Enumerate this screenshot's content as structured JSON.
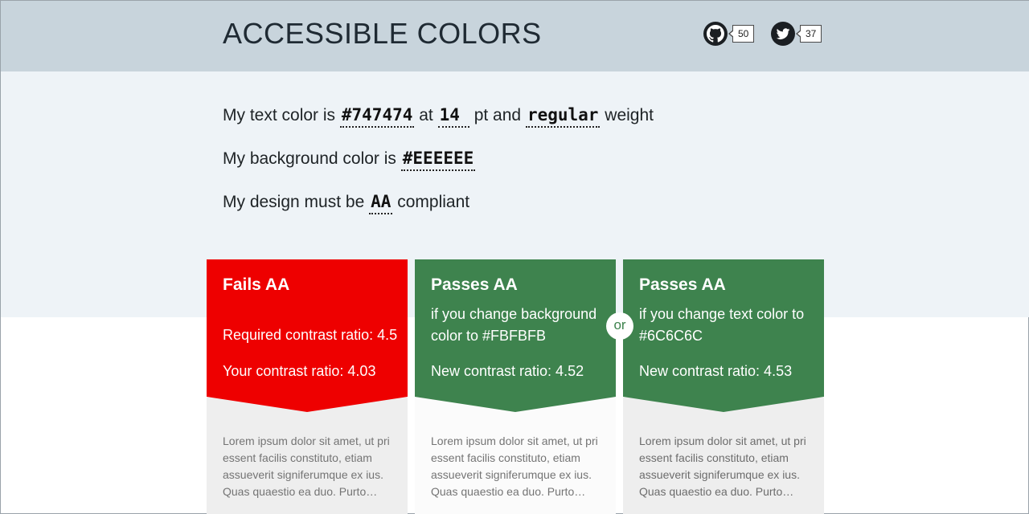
{
  "header": {
    "title": "ACCESSIBLE COLORS",
    "github": {
      "icon": "github-icon",
      "count": "50"
    },
    "twitter": {
      "icon": "twitter-icon",
      "count": "37"
    }
  },
  "config": {
    "line1": {
      "prefix": "My text color is ",
      "text_color": "#747474",
      "at": " at ",
      "size": "14",
      "pt_and": " pt and ",
      "weight": "regular",
      "suffix": " weight"
    },
    "line2": {
      "prefix": "My background color is ",
      "bg_color": "#EEEEEE"
    },
    "line3": {
      "prefix": "My design must be ",
      "level": "AA",
      "suffix": " compliant"
    }
  },
  "cards": [
    {
      "title": "Fails AA",
      "required": "Required contrast ratio: 4.5",
      "ratio": "Your contrast ratio: 4.03",
      "sample": "Lorem ipsum dolor sit amet, ut pri essent facilis constituto, etiam assueverit signiferumque ex ius. Quas quaestio ea duo. Purto…",
      "color": "#ee0000"
    },
    {
      "title": "Passes AA",
      "suggestion": "if you change background color to #FBFBFB",
      "ratio": "New contrast ratio: 4.52",
      "sample": "Lorem ipsum dolor sit amet, ut pri essent facilis constituto, etiam assueverit signiferumque ex ius. Quas quaestio ea duo. Purto…",
      "color": "#3e834e"
    },
    {
      "title": "Passes AA",
      "suggestion": "if you change text color to #6C6C6C",
      "ratio": "New contrast ratio: 4.53",
      "sample": "Lorem ipsum dolor sit amet, ut pri essent facilis constituto, etiam assueverit signiferumque ex ius. Quas quaestio ea duo. Purto…",
      "color": "#3e834e"
    }
  ],
  "or_label": "or",
  "colors": {
    "header_bg": "#c8d4dc",
    "config_bg": "#eef3f7",
    "fail": "#ee0000",
    "pass": "#3e834e"
  }
}
